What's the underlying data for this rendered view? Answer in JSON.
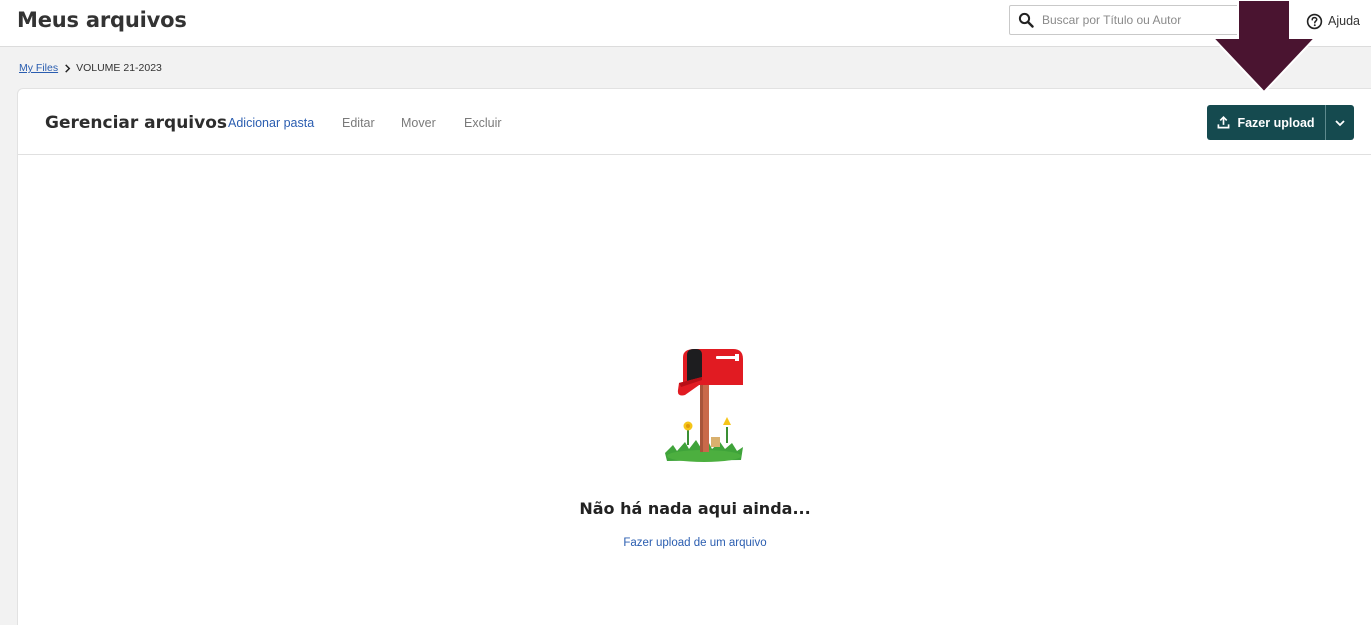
{
  "header": {
    "title": "Meus arquivos",
    "search": {
      "placeholder": "Buscar por Título ou Autor",
      "value": ""
    },
    "help_label": "Ajuda"
  },
  "breadcrumb": {
    "root": "My Files",
    "current": "VOLUME 21-2023"
  },
  "toolbar": {
    "title": "Gerenciar arquivos",
    "actions": {
      "add_folder": "Adicionar pasta",
      "edit": "Editar",
      "move": "Mover",
      "delete": "Excluir"
    },
    "upload_label": "Fazer upload"
  },
  "empty_state": {
    "title": "Não há nada aqui ainda...",
    "link": "Fazer upload de um arquivo"
  },
  "colors": {
    "accent": "#154a4f",
    "link": "#2a5db0",
    "mailbox_red": "#e11b22",
    "annotation_arrow": "#4a1430"
  },
  "icons": {
    "search": "search-icon",
    "help": "help-circle-icon",
    "breadcrumb_separator": "chevron-right-icon",
    "upload": "upload-icon",
    "dropdown": "chevron-down-icon",
    "illustration": "mailbox-illustration"
  }
}
